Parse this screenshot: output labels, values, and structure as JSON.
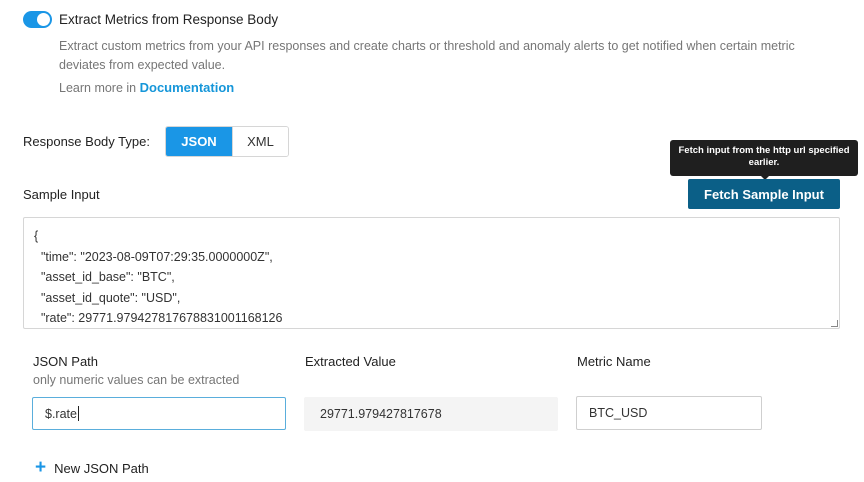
{
  "toggle": {
    "label": "Extract Metrics from Response Body",
    "enabled": true,
    "color": "#1a96e6"
  },
  "description": "Extract custom metrics from your API responses and create charts or threshold and anomaly alerts to get notified when certain metric deviates from expected value.",
  "learn_more": {
    "prefix": "Learn more in",
    "link_text": "Documentation"
  },
  "response_body_type": {
    "label": "Response Body Type:",
    "options": [
      "JSON",
      "XML"
    ],
    "selected": "JSON"
  },
  "tooltip": "Fetch input from the http url specified earlier.",
  "sample_input": {
    "label": "Sample Input",
    "fetch_button": "Fetch Sample Input",
    "lines": [
      "{",
      "  \"time\": \"2023-08-09T07:29:35.0000000Z\",",
      "  \"asset_id_base\": \"BTC\",",
      "  \"asset_id_quote\": \"USD\",",
      "  \"rate\": 29771.979427817678831001168126",
      "}"
    ]
  },
  "columns": {
    "json_path": {
      "title": "JSON Path",
      "subtitle": "only numeric values can be extracted",
      "value": "$.rate"
    },
    "extracted_value": {
      "title": "Extracted Value",
      "value": "29771.979427817678"
    },
    "metric_name": {
      "title": "Metric Name",
      "value": "BTC_USD"
    }
  },
  "add_path": {
    "icon": "plus-icon",
    "label": "New JSON Path"
  }
}
